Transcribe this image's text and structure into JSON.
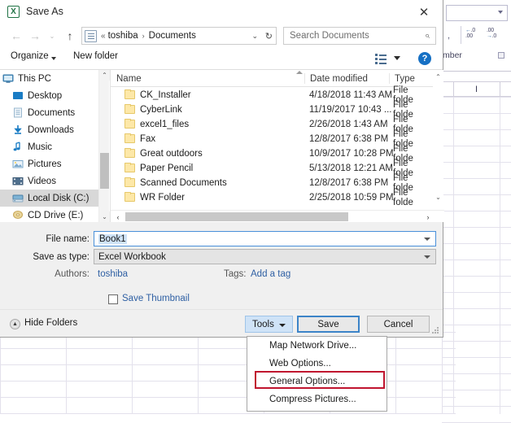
{
  "dialog": {
    "title": "Save As",
    "title_icon": "excel-icon",
    "close_label": "✕",
    "nav": {
      "back_icon": "←",
      "forward_icon": "→",
      "recent_icon": "⌄",
      "up_icon": "↑",
      "address_icon": "documents-folder-icon",
      "breadcrumb_prefix": "«",
      "crumbs": [
        "toshiba",
        "Documents"
      ],
      "crumb_separator": "›",
      "dropdown_icon": "⌄",
      "refresh_icon": "↻",
      "search_placeholder": "Search Documents",
      "search_value": "",
      "search_icon": "⌕"
    },
    "toolbar": {
      "organize_label": "Organize",
      "new_folder_label": "New folder",
      "view_icon": "list-view-icon",
      "help_label": "?"
    },
    "sidebar": {
      "items": [
        {
          "label": "This PC",
          "icon": "computer-icon",
          "indent": false,
          "selected": false
        },
        {
          "label": "Desktop",
          "icon": "desktop-icon",
          "indent": true,
          "selected": false
        },
        {
          "label": "Documents",
          "icon": "documents-icon",
          "indent": true,
          "selected": false
        },
        {
          "label": "Downloads",
          "icon": "downloads-icon",
          "indent": true,
          "selected": false
        },
        {
          "label": "Music",
          "icon": "music-icon",
          "indent": true,
          "selected": false
        },
        {
          "label": "Pictures",
          "icon": "pictures-icon",
          "indent": true,
          "selected": false
        },
        {
          "label": "Videos",
          "icon": "videos-icon",
          "indent": true,
          "selected": false
        },
        {
          "label": "Local Disk (C:)",
          "icon": "harddisk-icon",
          "indent": true,
          "selected": true
        },
        {
          "label": "CD Drive (E:)",
          "icon": "cddrive-icon",
          "indent": true,
          "selected": false
        }
      ]
    },
    "filelist": {
      "columns": [
        "Name",
        "Date modified",
        "Type"
      ],
      "sort_column": "Name",
      "sort_direction": "ascending",
      "rows": [
        {
          "name": "CK_Installer",
          "date": "4/18/2018 11:43 AM",
          "type": "File folde"
        },
        {
          "name": "CyberLink",
          "date": "11/19/2017 10:43 ...",
          "type": "File folde"
        },
        {
          "name": "excel1_files",
          "date": "2/26/2018 1:43 AM",
          "type": "File folde"
        },
        {
          "name": "Fax",
          "date": "12/8/2017 6:38 PM",
          "type": "File folde"
        },
        {
          "name": "Great outdoors",
          "date": "10/9/2017 10:28 PM",
          "type": "File folde"
        },
        {
          "name": "Paper Pencil",
          "date": "5/13/2018 12:21 AM",
          "type": "File folde"
        },
        {
          "name": "Scanned Documents",
          "date": "12/8/2017 6:38 PM",
          "type": "File folde"
        },
        {
          "name": "WR Folder",
          "date": "2/25/2018 10:59 PM",
          "type": "File folde"
        }
      ],
      "scroll_up_icon": "⌃",
      "scroll_down_icon": "⌄",
      "scroll_left_icon": "‹",
      "scroll_right_icon": "›"
    },
    "form": {
      "filename_label": "File name:",
      "filename_value": "Book1",
      "savetype_label": "Save as type:",
      "savetype_value": "Excel Workbook",
      "authors_label": "Authors:",
      "authors_value": "toshiba",
      "tags_label": "Tags:",
      "tags_value": "Add a tag",
      "thumbnail_label": "Save Thumbnail",
      "thumbnail_checked": false
    },
    "footer": {
      "hide_folders_label": "Hide Folders",
      "hide_folders_icon": "▲",
      "tools_label": "Tools",
      "save_label": "Save",
      "cancel_label": "Cancel"
    }
  },
  "tools_menu": {
    "items": [
      {
        "label": "Map Network Drive...",
        "highlighted": false
      },
      {
        "label": "Web Options...",
        "highlighted": false
      },
      {
        "label": "General Options...",
        "highlighted": true
      },
      {
        "label": "Compress Pictures...",
        "highlighted": false
      }
    ],
    "highlight_color": "#c0152f"
  },
  "excel_background": {
    "number_group_label": "mber",
    "column_header": "I",
    "comma_style_icon": "comma-style-icon",
    "increase_decimal_icon": "increase-decimal-icon",
    "decrease_decimal_icon": "decrease-decimal-icon"
  }
}
